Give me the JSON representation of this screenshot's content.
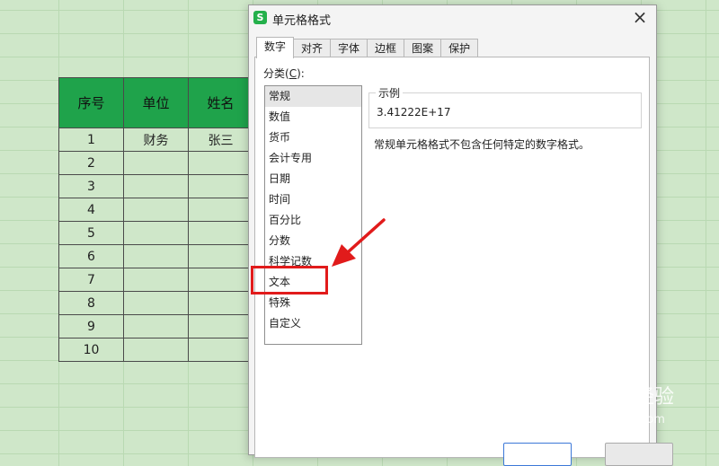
{
  "sheet": {
    "headers": [
      "序号",
      "单位",
      "姓名"
    ],
    "rows": [
      [
        "1",
        "财务",
        "张三"
      ],
      [
        "2",
        "",
        ""
      ],
      [
        "3",
        "",
        ""
      ],
      [
        "4",
        "",
        ""
      ],
      [
        "5",
        "",
        ""
      ],
      [
        "6",
        "",
        ""
      ],
      [
        "7",
        "",
        ""
      ],
      [
        "8",
        "",
        ""
      ],
      [
        "9",
        "",
        ""
      ],
      [
        "10",
        "",
        ""
      ]
    ],
    "colors": {
      "header_bg": "#1fa34b",
      "sheet_bg": "#cfe7c9"
    }
  },
  "dialog": {
    "title": "单元格格式",
    "app_icon": "S",
    "close_icon": "×",
    "tabs": [
      "数字",
      "对齐",
      "字体",
      "边框",
      "图案",
      "保护"
    ],
    "active_tab": "数字",
    "category_label_prefix": "分类(",
    "category_label_key": "C",
    "category_label_suffix": "):",
    "categories": [
      "常规",
      "数值",
      "货币",
      "会计专用",
      "日期",
      "时间",
      "百分比",
      "分数",
      "科学记数",
      "文本",
      "特殊",
      "自定义"
    ],
    "selected_category": "常规",
    "sample_legend": "示例",
    "sample_value": "3.41222E+17",
    "description": "常规单元格格式不包含任何特定的数字格式。"
  },
  "annotation": {
    "color": "#e11b1b",
    "highlighted_item": "文本"
  },
  "watermark": {
    "logo": "Bai",
    "cn": "经验",
    "url": "jingyan.baidu.com"
  }
}
